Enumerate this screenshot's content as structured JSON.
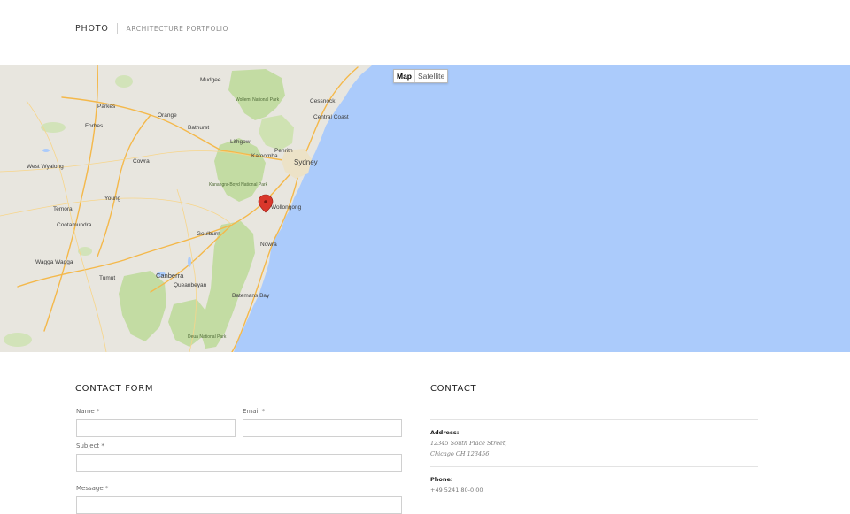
{
  "header": {
    "brand": "PHOTO",
    "tagline": "ARCHITECTURE PORTFOLIO"
  },
  "map": {
    "type_control": {
      "map_label": "Map",
      "satellite_label": "Satellite",
      "selected": "Map"
    },
    "labels": {
      "sydney": "Sydney",
      "canberra": "Canberra",
      "wollongong": "Wollongong",
      "central_coast": "Central Coast",
      "bathurst": "Bathurst",
      "orange": "Orange",
      "goulburn": "Goulburn",
      "wagga_wagga": "Wagga Wagga",
      "cowra": "Cowra",
      "young": "Young",
      "parkes": "Parkes",
      "forbes": "Forbes",
      "lithgow": "Lithgow",
      "katoomba": "Katoomba",
      "penrith": "Penrith",
      "nowra": "Nowra",
      "cessnock": "Cessnock",
      "batemans_bay": "Batemans Bay",
      "queanbeyan": "Queanbeyan",
      "west_wyalong": "West Wyalong",
      "temora": "Temora",
      "cootamundra": "Cootamundra",
      "tumut": "Tumut",
      "mudgee": "Mudgee",
      "wollemi": "Wollemi National Park",
      "kanangra": "Kanangra-Boyd National Park",
      "deua": "Deua National Park"
    },
    "colors": {
      "land": "#e8e6df",
      "water": "#abcbfb",
      "park": "#c3dca3",
      "road": "#f4b84a",
      "marker": "#d9372b"
    }
  },
  "contact_form": {
    "title": "CONTACT FORM",
    "name_label": "Name",
    "email_label": "Email",
    "subject_label": "Subject",
    "message_label": "Message",
    "required_marker": "*"
  },
  "contact": {
    "title": "CONTACT",
    "address_label": "Address:",
    "address_line1": "12345 South Place Street,",
    "address_line2": "Chicago CH 123456",
    "phone_label": "Phone:",
    "phone_value": "+49 5241 80-0 00"
  }
}
